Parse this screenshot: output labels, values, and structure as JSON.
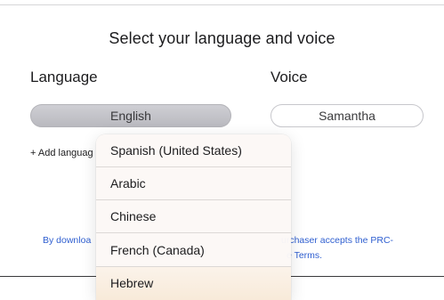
{
  "header": {
    "title": "Select your language and voice"
  },
  "language": {
    "label": "Language",
    "selected": "English",
    "add_label": "+ Add languag",
    "options": [
      "Spanish (United States)",
      "Arabic",
      "Chinese",
      "French (Canada)",
      "Hebrew"
    ]
  },
  "voice": {
    "label": "Voice",
    "selected": "Samantha"
  },
  "legal": {
    "left_fragment": "By downloa",
    "right_fragment_line1": "urchaser accepts the PRC-",
    "right_fragment_line2": "e Terms."
  },
  "colors": {
    "link": "#2f5fd0",
    "selected_pill": "#c4c4c9",
    "menu_background": "#fcf8f6"
  }
}
